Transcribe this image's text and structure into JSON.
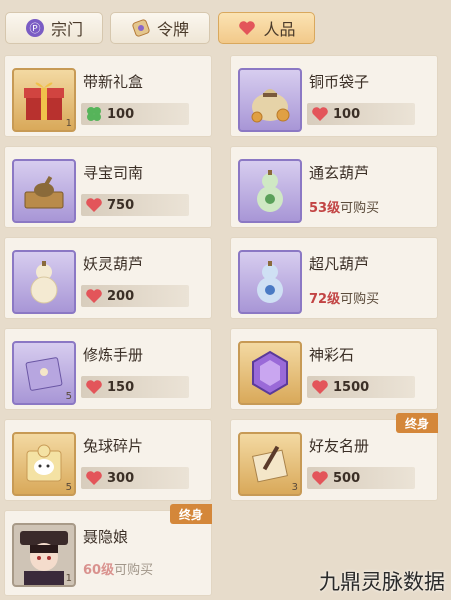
{
  "tabs": [
    {
      "label": "宗门",
      "icon": "sect-icon",
      "active": false
    },
    {
      "label": "令牌",
      "icon": "token-icon",
      "active": false
    },
    {
      "label": "人品",
      "icon": "heart-icon",
      "active": true
    }
  ],
  "items": [
    {
      "name": "带新礼盒",
      "price": "100",
      "currency": "clover-icon",
      "count": "1",
      "icon": "gift-box-icon",
      "frame": "gold"
    },
    {
      "name": "铜币袋子",
      "price": "100",
      "currency": "heart-icon",
      "icon": "coin-bag-icon",
      "frame": "purple"
    },
    {
      "name": "寻宝司南",
      "price": "750",
      "currency": "heart-icon",
      "icon": "compass-spoon-icon",
      "frame": "purple"
    },
    {
      "name": "通玄葫芦",
      "level": "53级",
      "level_suffix": "可购买",
      "icon": "gourd-icon",
      "frame": "purple"
    },
    {
      "name": "妖灵葫芦",
      "price": "200",
      "currency": "heart-icon",
      "icon": "gourd-icon",
      "frame": "purple"
    },
    {
      "name": "超凡葫芦",
      "level": "72级",
      "level_suffix": "可购买",
      "icon": "gourd-icon",
      "frame": "purple"
    },
    {
      "name": "修炼手册",
      "price": "150",
      "currency": "heart-icon",
      "count": "5",
      "icon": "manual-book-icon",
      "frame": "purple"
    },
    {
      "name": "神彩石",
      "price": "1500",
      "currency": "heart-icon",
      "icon": "gem-icon",
      "frame": "gold"
    },
    {
      "name": "兔球碎片",
      "price": "300",
      "currency": "heart-icon",
      "count": "5",
      "icon": "puzzle-piece-icon",
      "frame": "gold"
    },
    {
      "name": "好友名册",
      "price": "500",
      "currency": "heart-icon",
      "count": "3",
      "badge": "终身",
      "icon": "roster-scroll-icon",
      "frame": "gold"
    },
    {
      "name": "聂隐娘",
      "level": "60级",
      "level_suffix": "可购买",
      "count": "1",
      "badge": "终身",
      "icon": "character-portrait-icon",
      "frame": "gold"
    }
  ],
  "watermark": "九鼎灵脉数据",
  "colors": {
    "background": "#e7dccb",
    "card": "#f7f2ea",
    "badge": "#d4873a",
    "level_red": "#c24444"
  }
}
